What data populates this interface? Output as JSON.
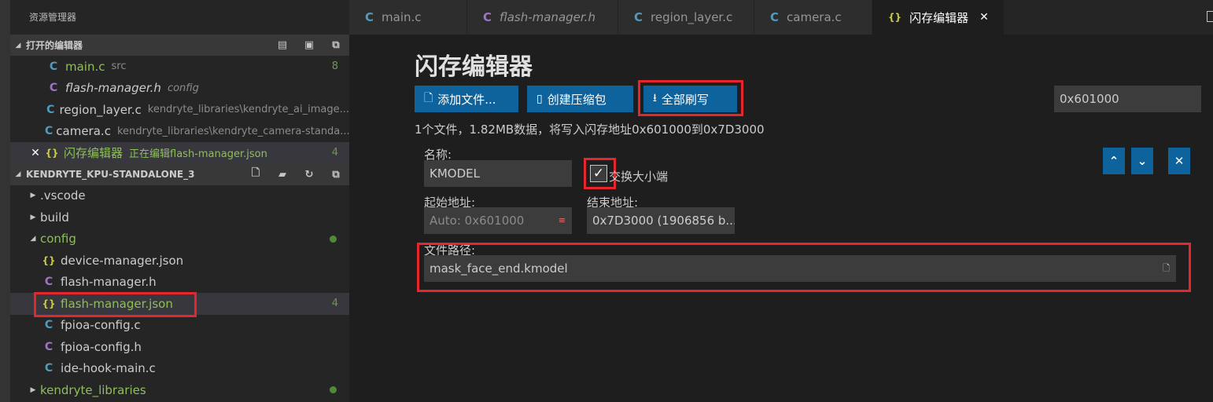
{
  "sidebar": {
    "title": "资源管理器",
    "open_editors": {
      "header": "打开的编辑器",
      "items": [
        {
          "name": "main.c",
          "desc": "src",
          "badge": "8"
        },
        {
          "name": "flash-manager.h",
          "desc": "config",
          "badge": ""
        },
        {
          "name": "region_layer.c",
          "desc": "kendryte_libraries\\kendryte_ai_image...",
          "badge": ""
        },
        {
          "name": "camera.c",
          "desc": "kendryte_libraries\\kendryte_camera-standa...",
          "badge": ""
        },
        {
          "name": "闪存编辑器",
          "desc": "正在编辑flash-manager.json",
          "badge": "4"
        }
      ]
    },
    "project": {
      "header": "KENDRYTE_KPU-STANDALONE_3",
      "items": [
        {
          "name": ".vscode"
        },
        {
          "name": "build"
        },
        {
          "name": "config"
        },
        {
          "name": "device-manager.json"
        },
        {
          "name": "flash-manager.h"
        },
        {
          "name": "flash-manager.json",
          "badge": "4"
        },
        {
          "name": "fpioa-config.c"
        },
        {
          "name": "fpioa-config.h"
        },
        {
          "name": "ide-hook-main.c"
        },
        {
          "name": "kendryte_libraries"
        }
      ]
    }
  },
  "tabs": [
    {
      "label": "main.c",
      "icon": "C"
    },
    {
      "label": "flash-manager.h",
      "icon": "C"
    },
    {
      "label": "region_layer.c",
      "icon": "C"
    },
    {
      "label": "camera.c",
      "icon": "C"
    },
    {
      "label": "闪存编辑器",
      "icon": "{}"
    }
  ],
  "editor": {
    "title": "闪存编辑器",
    "buttons": {
      "add_file": "添加文件...",
      "create_package": "创建压缩包",
      "flash_all": "全部刷写"
    },
    "base_address": "0x601000",
    "summary": "1个文件，1.82MB数据，将写入闪存地址0x601000到0x7D3000",
    "entry": {
      "name_label": "名称:",
      "name_value": "KMODEL",
      "swap_endian_label": "交换大小端",
      "swap_endian_checked": true,
      "start_label": "起始地址:",
      "start_placeholder": "Auto: 0x601000",
      "end_label": "结束地址:",
      "end_value": "0x7D3000 (1906856 b...",
      "path_label": "文件路径:",
      "path_value": "mask_face_end.kmodel"
    }
  },
  "colors": {
    "accent_button": "#0e639c",
    "highlight_box": "#e5262d",
    "git_modified": "#73c991"
  }
}
